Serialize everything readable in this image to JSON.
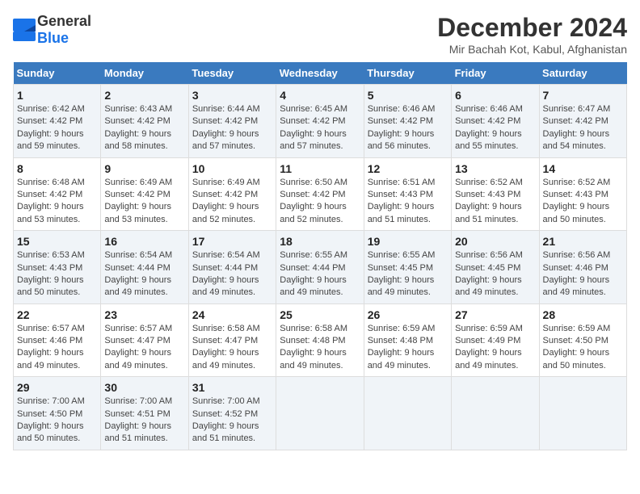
{
  "logo": {
    "general": "General",
    "blue": "Blue"
  },
  "title": "December 2024",
  "subtitle": "Mir Bachah Kot, Kabul, Afghanistan",
  "days_header": [
    "Sunday",
    "Monday",
    "Tuesday",
    "Wednesday",
    "Thursday",
    "Friday",
    "Saturday"
  ],
  "weeks": [
    [
      {
        "day": "1",
        "sunrise": "6:42 AM",
        "sunset": "4:42 PM",
        "daylight": "9 hours and 59 minutes."
      },
      {
        "day": "2",
        "sunrise": "6:43 AM",
        "sunset": "4:42 PM",
        "daylight": "9 hours and 58 minutes."
      },
      {
        "day": "3",
        "sunrise": "6:44 AM",
        "sunset": "4:42 PM",
        "daylight": "9 hours and 57 minutes."
      },
      {
        "day": "4",
        "sunrise": "6:45 AM",
        "sunset": "4:42 PM",
        "daylight": "9 hours and 57 minutes."
      },
      {
        "day": "5",
        "sunrise": "6:46 AM",
        "sunset": "4:42 PM",
        "daylight": "9 hours and 56 minutes."
      },
      {
        "day": "6",
        "sunrise": "6:46 AM",
        "sunset": "4:42 PM",
        "daylight": "9 hours and 55 minutes."
      },
      {
        "day": "7",
        "sunrise": "6:47 AM",
        "sunset": "4:42 PM",
        "daylight": "9 hours and 54 minutes."
      }
    ],
    [
      {
        "day": "8",
        "sunrise": "6:48 AM",
        "sunset": "4:42 PM",
        "daylight": "9 hours and 53 minutes."
      },
      {
        "day": "9",
        "sunrise": "6:49 AM",
        "sunset": "4:42 PM",
        "daylight": "9 hours and 53 minutes."
      },
      {
        "day": "10",
        "sunrise": "6:49 AM",
        "sunset": "4:42 PM",
        "daylight": "9 hours and 52 minutes."
      },
      {
        "day": "11",
        "sunrise": "6:50 AM",
        "sunset": "4:42 PM",
        "daylight": "9 hours and 52 minutes."
      },
      {
        "day": "12",
        "sunrise": "6:51 AM",
        "sunset": "4:43 PM",
        "daylight": "9 hours and 51 minutes."
      },
      {
        "day": "13",
        "sunrise": "6:52 AM",
        "sunset": "4:43 PM",
        "daylight": "9 hours and 51 minutes."
      },
      {
        "day": "14",
        "sunrise": "6:52 AM",
        "sunset": "4:43 PM",
        "daylight": "9 hours and 50 minutes."
      }
    ],
    [
      {
        "day": "15",
        "sunrise": "6:53 AM",
        "sunset": "4:43 PM",
        "daylight": "9 hours and 50 minutes."
      },
      {
        "day": "16",
        "sunrise": "6:54 AM",
        "sunset": "4:44 PM",
        "daylight": "9 hours and 49 minutes."
      },
      {
        "day": "17",
        "sunrise": "6:54 AM",
        "sunset": "4:44 PM",
        "daylight": "9 hours and 49 minutes."
      },
      {
        "day": "18",
        "sunrise": "6:55 AM",
        "sunset": "4:44 PM",
        "daylight": "9 hours and 49 minutes."
      },
      {
        "day": "19",
        "sunrise": "6:55 AM",
        "sunset": "4:45 PM",
        "daylight": "9 hours and 49 minutes."
      },
      {
        "day": "20",
        "sunrise": "6:56 AM",
        "sunset": "4:45 PM",
        "daylight": "9 hours and 49 minutes."
      },
      {
        "day": "21",
        "sunrise": "6:56 AM",
        "sunset": "4:46 PM",
        "daylight": "9 hours and 49 minutes."
      }
    ],
    [
      {
        "day": "22",
        "sunrise": "6:57 AM",
        "sunset": "4:46 PM",
        "daylight": "9 hours and 49 minutes."
      },
      {
        "day": "23",
        "sunrise": "6:57 AM",
        "sunset": "4:47 PM",
        "daylight": "9 hours and 49 minutes."
      },
      {
        "day": "24",
        "sunrise": "6:58 AM",
        "sunset": "4:47 PM",
        "daylight": "9 hours and 49 minutes."
      },
      {
        "day": "25",
        "sunrise": "6:58 AM",
        "sunset": "4:48 PM",
        "daylight": "9 hours and 49 minutes."
      },
      {
        "day": "26",
        "sunrise": "6:59 AM",
        "sunset": "4:48 PM",
        "daylight": "9 hours and 49 minutes."
      },
      {
        "day": "27",
        "sunrise": "6:59 AM",
        "sunset": "4:49 PM",
        "daylight": "9 hours and 49 minutes."
      },
      {
        "day": "28",
        "sunrise": "6:59 AM",
        "sunset": "4:50 PM",
        "daylight": "9 hours and 50 minutes."
      }
    ],
    [
      {
        "day": "29",
        "sunrise": "7:00 AM",
        "sunset": "4:50 PM",
        "daylight": "9 hours and 50 minutes."
      },
      {
        "day": "30",
        "sunrise": "7:00 AM",
        "sunset": "4:51 PM",
        "daylight": "9 hours and 51 minutes."
      },
      {
        "day": "31",
        "sunrise": "7:00 AM",
        "sunset": "4:52 PM",
        "daylight": "9 hours and 51 minutes."
      },
      null,
      null,
      null,
      null
    ]
  ],
  "labels": {
    "sunrise": "Sunrise:",
    "sunset": "Sunset:",
    "daylight": "Daylight:"
  }
}
